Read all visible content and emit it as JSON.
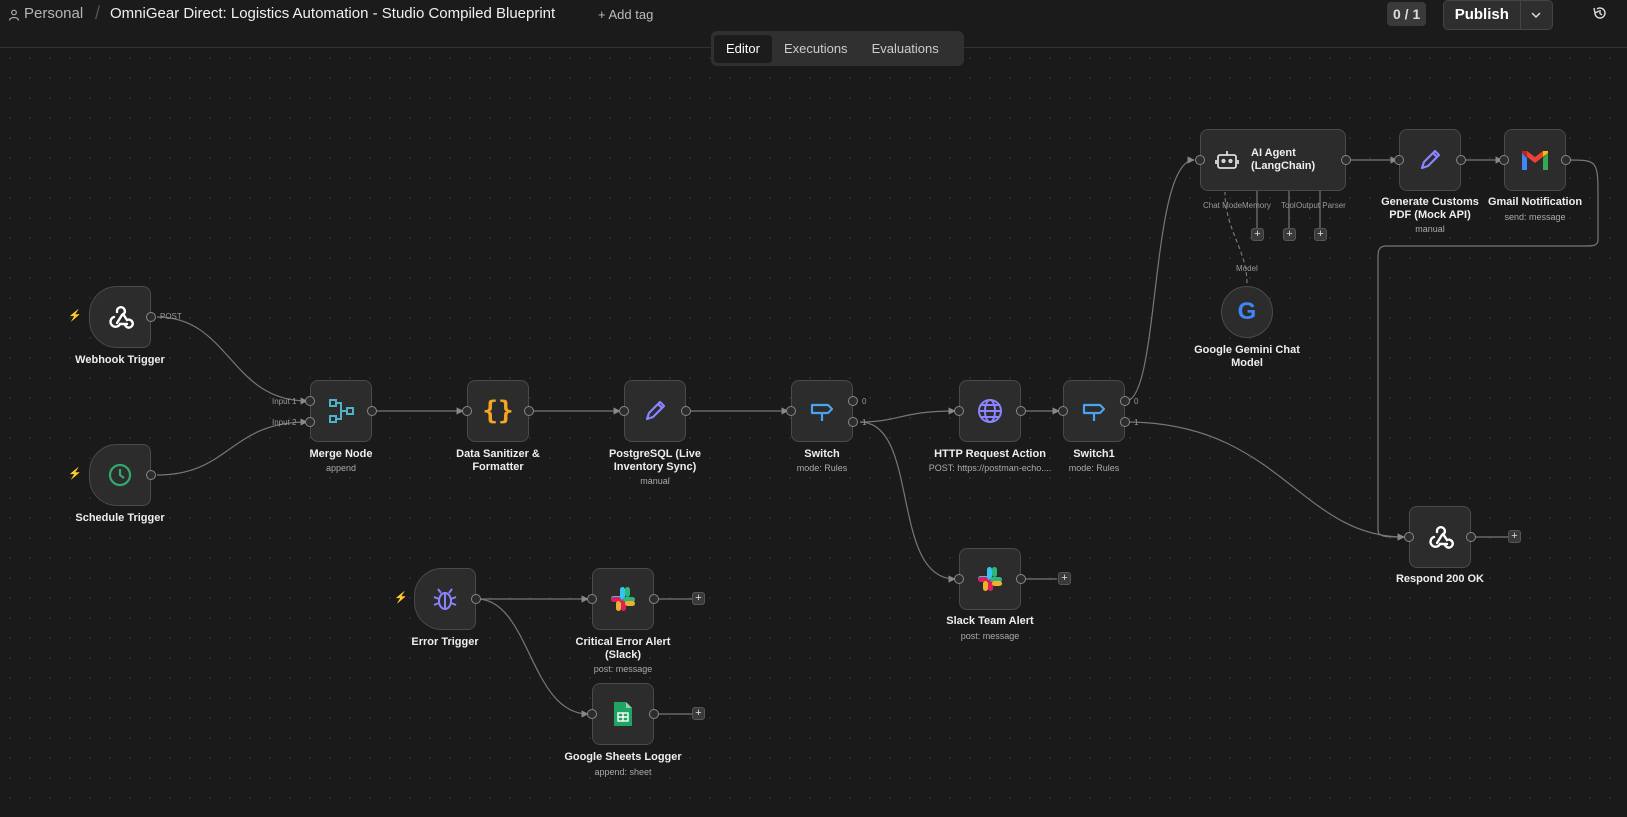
{
  "header": {
    "breadcrumb_personal": "Personal",
    "workflow_title": "OmniGear Direct: Logistics Automation - Studio Compiled Blueprint",
    "add_tag": "+ Add tag",
    "counter": "0 / 1",
    "publish_label": "Publish"
  },
  "tabs": [
    "Editor",
    "Executions",
    "Evaluations"
  ],
  "nodes": {
    "webhook_trigger": {
      "label": "Webhook Trigger",
      "port": "POST"
    },
    "schedule_trigger": {
      "label": "Schedule Trigger"
    },
    "merge": {
      "label": "Merge Node",
      "sub": "append",
      "input1": "Input 1",
      "input2": "Input 2"
    },
    "sanitizer": {
      "label": "Data Sanitizer & Formatter"
    },
    "postgres": {
      "label": "PostgreSQL (Live Inventory Sync)",
      "sub": "manual"
    },
    "switch": {
      "label": "Switch",
      "sub": "mode: Rules",
      "out0": "0",
      "out1": "1"
    },
    "http": {
      "label": "HTTP Request Action",
      "sub": "POST: https://postman-echo...."
    },
    "switch1": {
      "label": "Switch1",
      "sub": "mode: Rules",
      "out0": "0",
      "out1": "1"
    },
    "ai_agent": {
      "label": "AI Agent (LangChain)",
      "port_chat": "Chat Mode",
      "port_memory": "Memory",
      "port_tool": "Tool",
      "port_parser": "Output Parser"
    },
    "gemini": {
      "label": "Google Gemini Chat Model",
      "port": "Model"
    },
    "customs_pdf": {
      "label": "Generate Customs PDF (Mock API)",
      "sub": "manual"
    },
    "gmail": {
      "label": "Gmail Notification",
      "sub": "send: message"
    },
    "respond": {
      "label": "Respond 200 OK"
    },
    "slack_team": {
      "label": "Slack Team Alert",
      "sub": "post: message"
    },
    "error_trigger": {
      "label": "Error Trigger"
    },
    "critical_slack": {
      "label": "Critical Error Alert (Slack)",
      "sub": "post: message"
    },
    "sheets": {
      "label": "Google Sheets Logger",
      "sub": "append: sheet"
    }
  },
  "colors": {
    "accent_trigger": "#e05a4a",
    "schedule_green": "#35a86e",
    "merge_teal": "#4fb3c8",
    "code_orange": "#f5a524",
    "pen_purple": "#8a85ff",
    "switch_blue": "#4aa3f0",
    "http_purple": "#8a85ff"
  }
}
